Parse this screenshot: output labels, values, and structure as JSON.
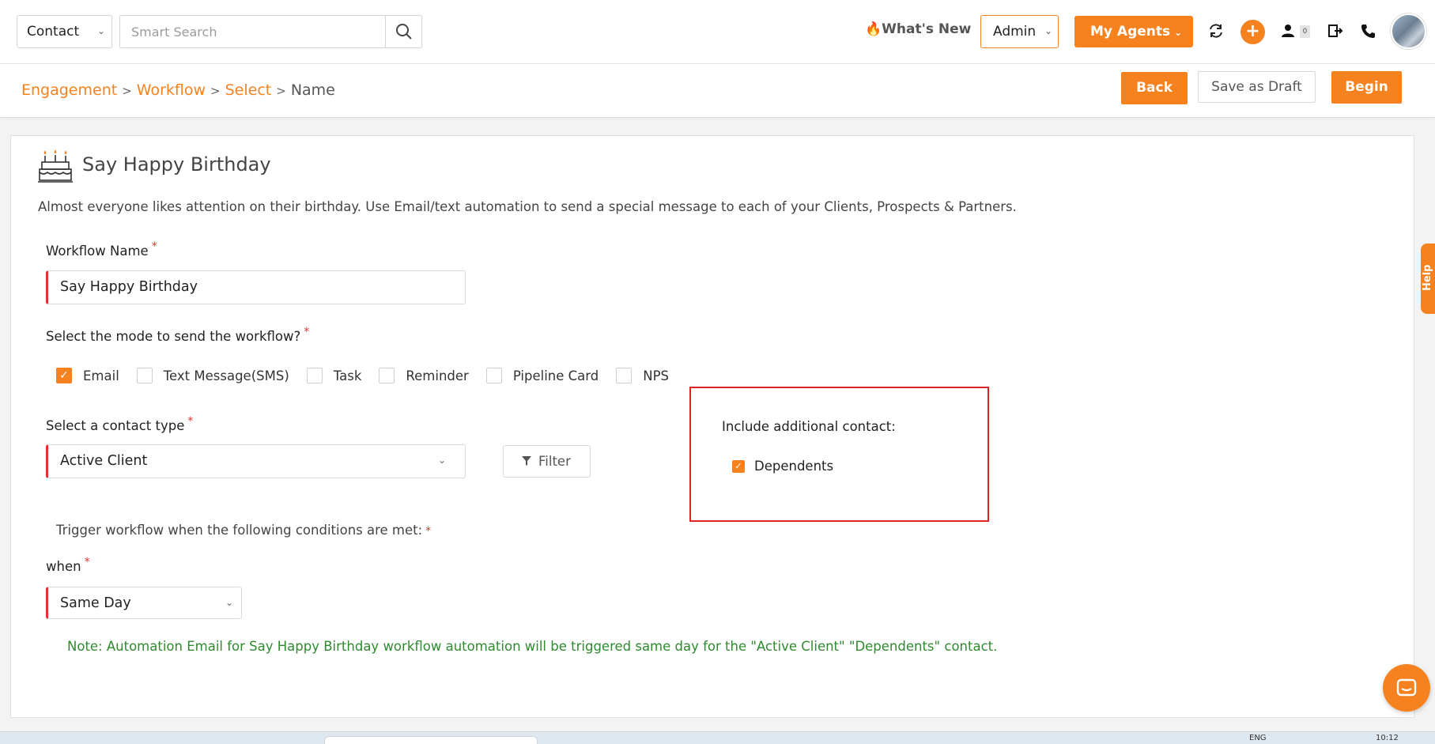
{
  "topbar": {
    "context_select": "Contact",
    "search": {
      "placeholder": "Smart Search"
    },
    "whats_new": "What's New",
    "role_select": "Admin",
    "my_agents": "My Agents",
    "people_count": "0"
  },
  "breadcrumb": {
    "items": [
      "Engagement",
      "Workflow",
      "Select"
    ],
    "current": "Name"
  },
  "actions": {
    "back": "Back",
    "save_draft": "Save as Draft",
    "begin": "Begin"
  },
  "card": {
    "title": "Say Happy Birthday",
    "description": "Almost everyone likes attention on their birthday. Use Email/text automation to send a special message to each of your Clients, Prospects & Partners.",
    "workflow_name": {
      "label": "Workflow Name",
      "value": "Say Happy Birthday"
    },
    "mode": {
      "label": "Select the mode to send the workflow?",
      "options": [
        {
          "label": "Email",
          "checked": true
        },
        {
          "label": "Text Message(SMS)",
          "checked": false
        },
        {
          "label": "Task",
          "checked": false
        },
        {
          "label": "Reminder",
          "checked": false
        },
        {
          "label": "Pipeline Card",
          "checked": false
        },
        {
          "label": "NPS",
          "checked": false
        }
      ]
    },
    "contact_type": {
      "label": "Select a contact type",
      "value": "Active Client",
      "filter": "Filter"
    },
    "include_additional": {
      "title": "Include additional contact:",
      "option": "Dependents",
      "checked": true
    },
    "trigger_label": "Trigger workflow when the following conditions are met:",
    "when": {
      "label": "when",
      "value": "Same Day"
    },
    "note": "Note: Automation Email for Say Happy Birthday workflow automation will be triggered same day for the \"Active Client\"  \"Dependents\" contact."
  },
  "help_tab": "Help",
  "taskbar": {
    "lang": "ENG",
    "time": "10:12"
  },
  "colors": {
    "accent": "#f5821f",
    "required": "#e3342f",
    "note": "#2e8b2e",
    "highlight_box": "#e02424"
  }
}
